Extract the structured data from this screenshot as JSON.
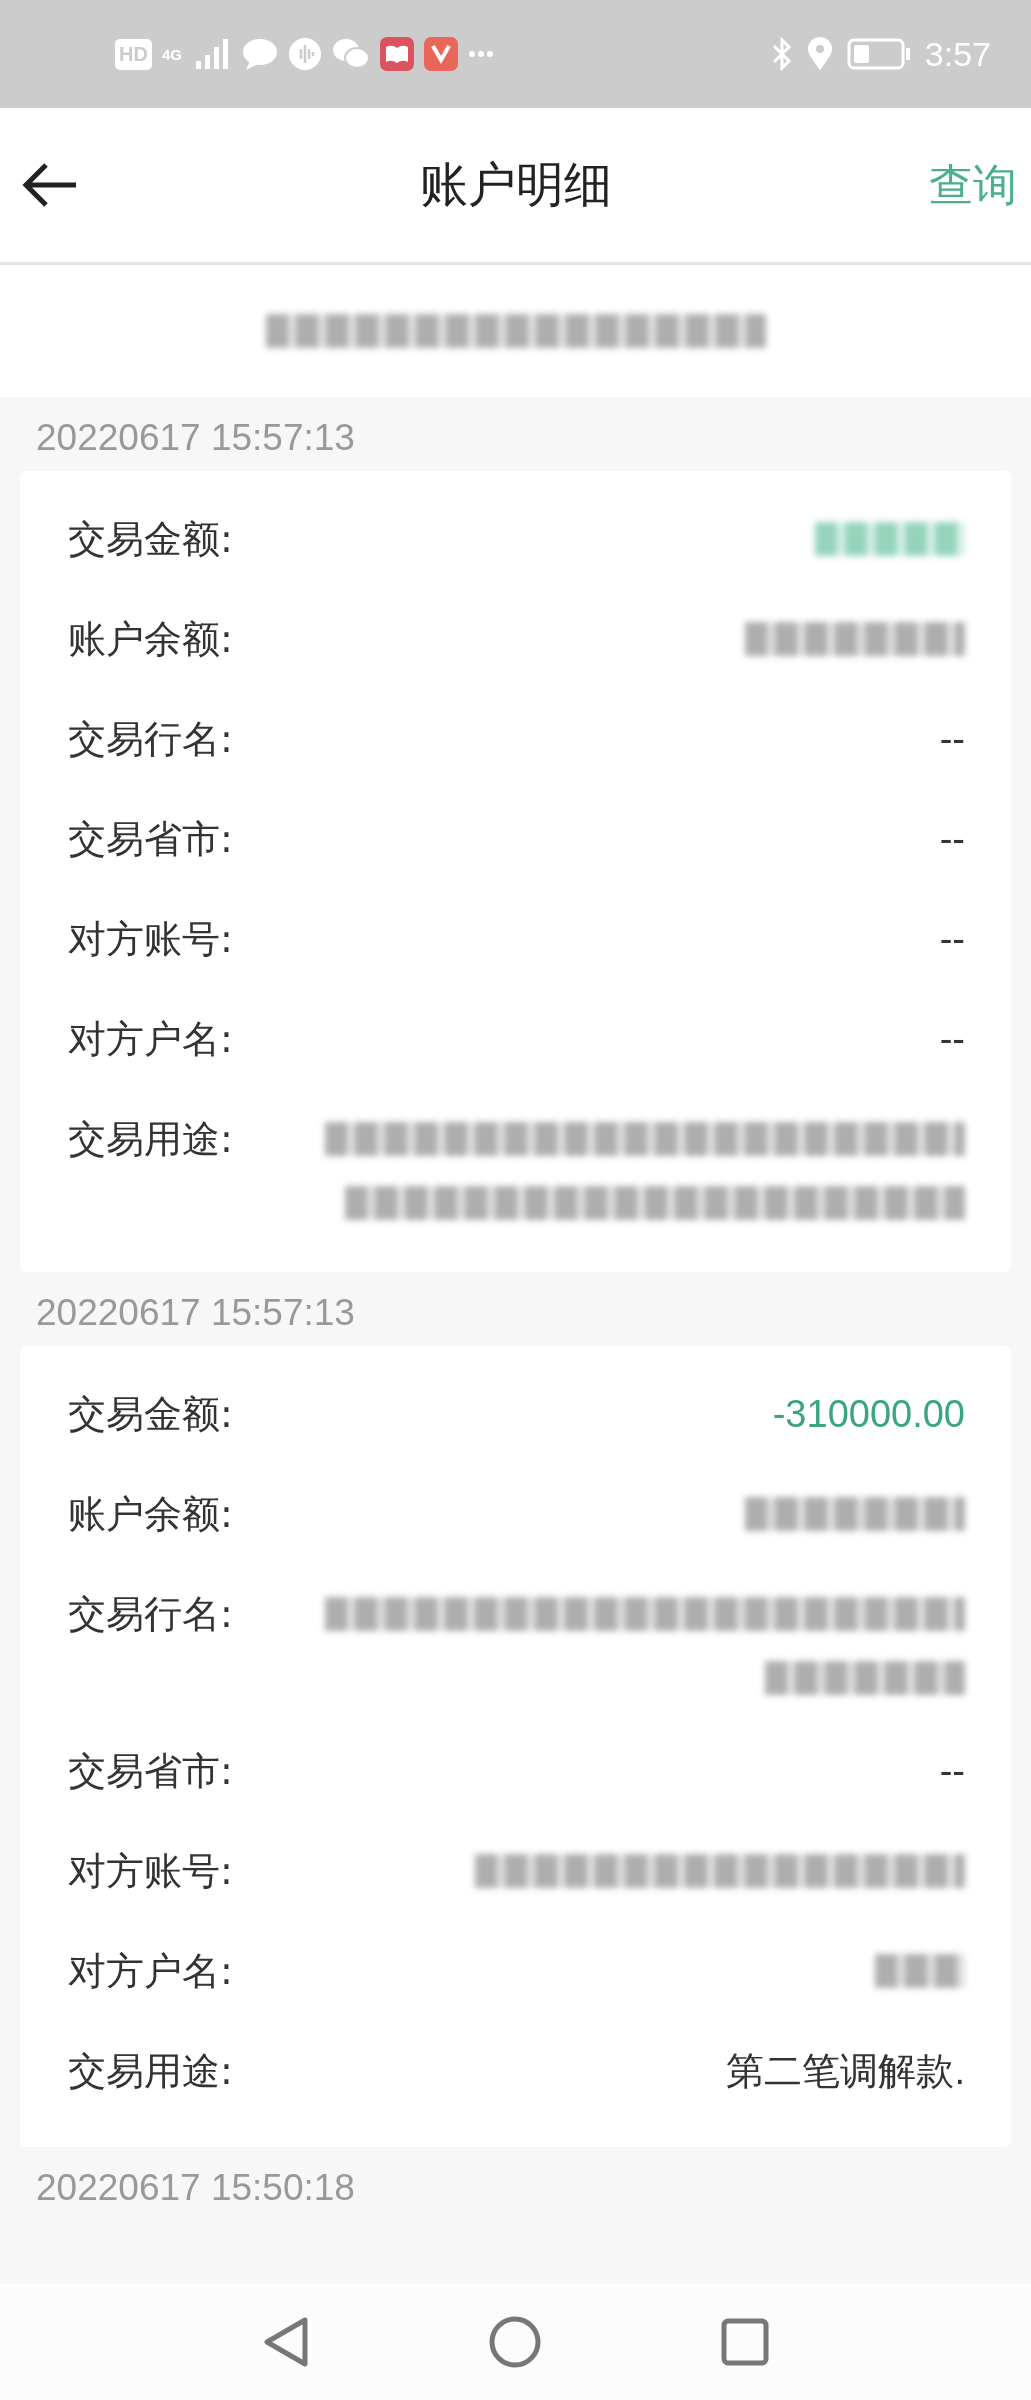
{
  "status_bar": {
    "hd": "HD",
    "network": "4G",
    "time": "3:57"
  },
  "header": {
    "title": "账户明细",
    "action": "查询"
  },
  "date_range": {
    "kind": "redacted"
  },
  "records": [
    {
      "time": "20220617 15:57:13",
      "fields": [
        {
          "label": "交易金额:",
          "kind": "redacted-amount"
        },
        {
          "label": "账户余额:",
          "kind": "redacted"
        },
        {
          "label": "交易行名:",
          "kind": "text",
          "value": "--"
        },
        {
          "label": "交易省市:",
          "kind": "text",
          "value": "--"
        },
        {
          "label": "对方账号:",
          "kind": "text",
          "value": "--"
        },
        {
          "label": "对方户名:",
          "kind": "text",
          "value": "--"
        },
        {
          "label": "交易用途:",
          "kind": "redacted-long"
        }
      ]
    },
    {
      "time": "20220617 15:57:13",
      "fields": [
        {
          "label": "交易金额:",
          "kind": "amount",
          "value": "-310000.00"
        },
        {
          "label": "账户余额:",
          "kind": "redacted"
        },
        {
          "label": "交易行名:",
          "kind": "redacted-long-short"
        },
        {
          "label": "交易省市:",
          "kind": "text",
          "value": "--"
        },
        {
          "label": "对方账号:",
          "kind": "redacted-wide"
        },
        {
          "label": "对方户名:",
          "kind": "redacted-tiny"
        },
        {
          "label": "交易用途:",
          "kind": "text",
          "value": "第二笔调解款."
        }
      ]
    },
    {
      "time": "20220617 15:50:18"
    }
  ]
}
